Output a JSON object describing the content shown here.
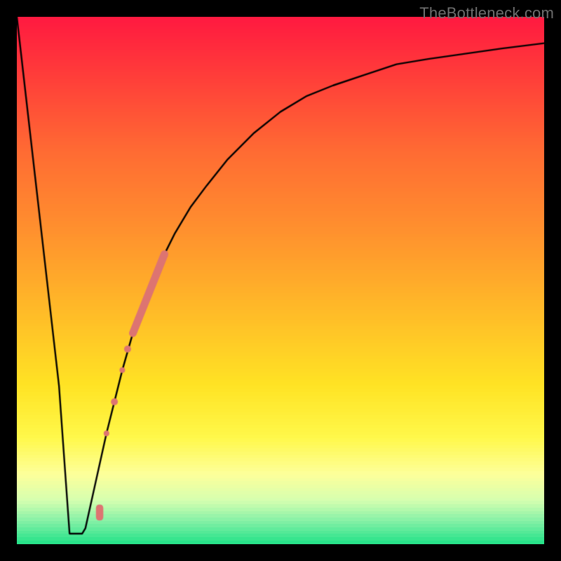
{
  "watermark": "TheBottleneck.com",
  "colors": {
    "line": "#000000",
    "marker": "#dd7471",
    "frame": "#000000"
  },
  "gradient": {
    "stops": [
      {
        "t": 0.0,
        "color": "#ff1a40"
      },
      {
        "t": 0.1,
        "color": "#ff3a3a"
      },
      {
        "t": 0.25,
        "color": "#ff6a33"
      },
      {
        "t": 0.4,
        "color": "#ff8f2e"
      },
      {
        "t": 0.55,
        "color": "#ffb828"
      },
      {
        "t": 0.7,
        "color": "#ffe324"
      },
      {
        "t": 0.8,
        "color": "#fff84a"
      },
      {
        "t": 0.87,
        "color": "#fdff9a"
      },
      {
        "t": 0.92,
        "color": "#d6ffb0"
      },
      {
        "t": 0.96,
        "color": "#84f0a6"
      },
      {
        "t": 1.0,
        "color": "#29e38a"
      }
    ]
  },
  "chart_data": {
    "type": "line",
    "title": "",
    "xlabel": "",
    "ylabel": "",
    "xlim": [
      0,
      100
    ],
    "ylim": [
      0,
      100
    ],
    "grid": false,
    "series": [
      {
        "name": "curve",
        "x": [
          0,
          4,
          8,
          10,
          11,
          12,
          13,
          15,
          17,
          20,
          22,
          24,
          26,
          28,
          30,
          33,
          36,
          40,
          45,
          50,
          55,
          60,
          66,
          72,
          78,
          85,
          92,
          100
        ],
        "y": [
          100,
          65,
          30,
          10,
          3,
          2,
          3,
          12,
          21,
          33,
          40,
          46,
          51,
          55,
          59,
          64,
          68,
          73,
          78,
          82,
          85,
          87,
          89,
          91,
          92,
          93,
          94,
          95
        ]
      }
    ],
    "flat_bottom": {
      "x0": 10.0,
      "x1": 12.4,
      "y": 2.0
    },
    "markers": [
      {
        "x": 17.0,
        "y": 21.0,
        "r": 4,
        "role": "dot"
      },
      {
        "x": 18.5,
        "y": 27.0,
        "r": 5,
        "role": "dot"
      },
      {
        "x": 20.0,
        "y": 33.0,
        "r": 4,
        "role": "dot"
      },
      {
        "x": 21.0,
        "y": 37.0,
        "r": 5,
        "role": "dot"
      }
    ],
    "thick_segment": {
      "x0": 22.0,
      "y0": 40.0,
      "x1": 28.0,
      "y1": 55.0,
      "width": 11
    },
    "tiny_bar": {
      "x": 15.7,
      "y": 4.5,
      "w": 1.4,
      "h": 3.0
    }
  }
}
